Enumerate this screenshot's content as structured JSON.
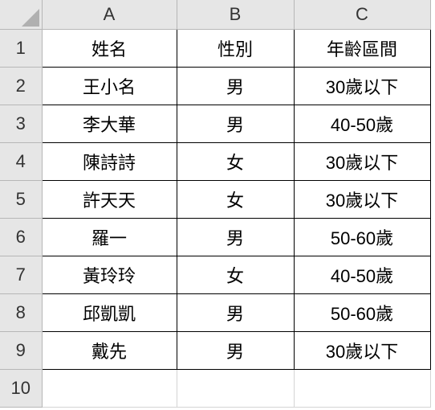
{
  "columns": [
    "A",
    "B",
    "C"
  ],
  "row_numbers": [
    "1",
    "2",
    "3",
    "4",
    "5",
    "6",
    "7",
    "8",
    "9",
    "10"
  ],
  "chart_data": {
    "type": "table",
    "headers": [
      "姓名",
      "性別",
      "年齡區間"
    ],
    "rows": [
      [
        "王小名",
        "男",
        "30歲以下"
      ],
      [
        "李大華",
        "男",
        "40-50歲"
      ],
      [
        "陳詩詩",
        "女",
        "30歲以下"
      ],
      [
        "許天天",
        "女",
        "30歲以下"
      ],
      [
        "羅一",
        "男",
        "50-60歲"
      ],
      [
        "黃玲玲",
        "女",
        "40-50歲"
      ],
      [
        "邱凱凱",
        "男",
        "50-60歲"
      ],
      [
        "戴先",
        "男",
        "30歲以下"
      ]
    ]
  }
}
